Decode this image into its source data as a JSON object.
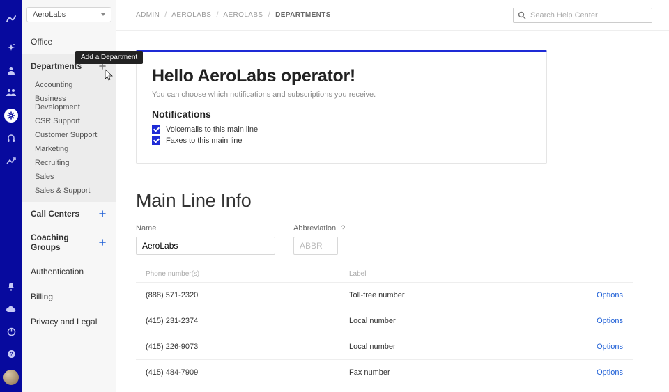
{
  "orgSelect": "AeroLabs",
  "tooltip": "Add a Department",
  "sidebar": {
    "office": "Office",
    "departments": {
      "label": "Departments",
      "items": [
        "Accounting",
        "Business Development",
        "CSR Support",
        "Customer Support",
        "Marketing",
        "Recruiting",
        "Sales",
        "Sales & Support"
      ]
    },
    "callCenters": "Call Centers",
    "coachingGroups": "Coaching Groups",
    "authentication": "Authentication",
    "billing": "Billing",
    "privacy": "Privacy and Legal"
  },
  "breadcrumbs": {
    "seg1": "ADMIN",
    "seg2": "AEROLABS",
    "seg3": "AEROLABS",
    "current": "DEPARTMENTS",
    "sep": "/"
  },
  "search": {
    "placeholder": "Search Help Center"
  },
  "hero": {
    "title": "Hello AeroLabs operator!",
    "subtitle": "You can choose which notifications and subscriptions you receive.",
    "notifHeader": "Notifications",
    "chk1": "Voicemails to this main line",
    "chk2": "Faxes to this main line"
  },
  "mainLine": {
    "title": "Main Line Info",
    "nameLabel": "Name",
    "nameValue": "AeroLabs",
    "abbrLabel": "Abbreviation",
    "abbrHelp": "?",
    "abbrPlaceholder": "ABBR"
  },
  "phoneTable": {
    "headNum": "Phone number(s)",
    "headLabel": "Label",
    "optionsLabel": "Options",
    "rows": [
      {
        "num": "(888) 571-2320",
        "label": "Toll-free number"
      },
      {
        "num": "(415) 231-2374",
        "label": "Local number"
      },
      {
        "num": "(415) 226-9073",
        "label": "Local number"
      },
      {
        "num": "(415) 484-7909",
        "label": "Fax number"
      }
    ]
  },
  "colors": {
    "accent": "#1e2bd6",
    "railBg": "#070a9e"
  }
}
